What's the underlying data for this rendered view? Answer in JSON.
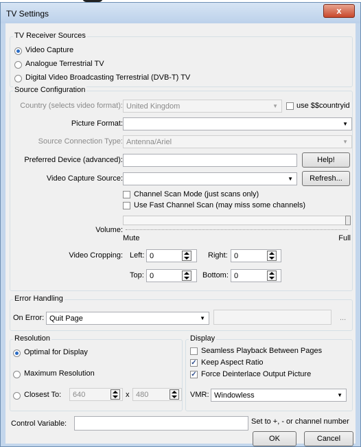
{
  "window": {
    "title": "TV Settings",
    "close_glyph": "x"
  },
  "receiver": {
    "legend": "TV Receiver Sources",
    "options": [
      {
        "label": "Video Capture",
        "checked": true
      },
      {
        "label": "Analogue Terrestrial TV",
        "checked": false
      },
      {
        "label": "Digital Video Broadcasting Terrestrial (DVB-T) TV",
        "checked": false
      }
    ]
  },
  "source": {
    "legend": "Source Configuration",
    "country_label": "Country (selects video format):",
    "country_value": "United Kingdom",
    "countryid_label": "use $$countryid",
    "picture_format_label": "Picture Format:",
    "picture_format_value": "",
    "connection_label": "Source Connection Type:",
    "connection_value": "Antenna/Ariel",
    "device_label": "Preferred Device (advanced):",
    "device_value": "",
    "help_button": "Help!",
    "capture_label": "Video Capture Source:",
    "capture_value": "",
    "refresh_button": "Refresh...",
    "scan_mode_label": "Channel Scan Mode (just scans only)",
    "fast_scan_label": "Use Fast Channel Scan (may miss some channels)",
    "volume_label": "Volume:",
    "volume_min": "Mute",
    "volume_max": "Full",
    "volume_level": 1.0,
    "cropping_label": "Video Cropping:",
    "left_label": "Left:",
    "left_value": "0",
    "right_label": "Right:",
    "right_value": "0",
    "top_label": "Top:",
    "top_value": "0",
    "bottom_label": "Bottom:",
    "bottom_value": "0"
  },
  "error": {
    "legend": "Error Handling",
    "on_error_label": "On Error:",
    "on_error_value": "Quit Page",
    "extra_button": "..."
  },
  "resolution": {
    "legend": "Resolution",
    "optimal_label": "Optimal for Display",
    "maximum_label": "Maximum Resolution",
    "closest_label": "Closest To:",
    "width_value": "640",
    "times": "x",
    "height_value": "480"
  },
  "display": {
    "legend": "Display",
    "seamless_label": "Seamless Playback Between Pages",
    "seamless_checked": false,
    "aspect_label": "Keep Aspect Ratio",
    "aspect_checked": true,
    "deinterlace_label": "Force Deinterlace Output Picture",
    "deinterlace_checked": true,
    "vmr_label": "VMR:",
    "vmr_value": "Windowless"
  },
  "control": {
    "label": "Control Variable:",
    "value": "",
    "hint": "Set to +, - or channel number"
  },
  "footer": {
    "ok": "OK",
    "cancel": "Cancel"
  }
}
